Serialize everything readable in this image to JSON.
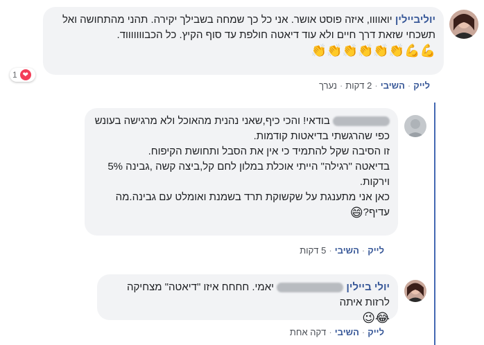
{
  "comment1": {
    "author": "יוליביילין",
    "text": "יואוווו, איזה פוסט אושר. אני כל כך שמחה בשבילך יקירה. תהני מהתחושה ואל תשכחי שזאת דרך חיים ולא עוד דיאטה חולפת עד סוף הקיץ. כל הכבוווווווד.",
    "emojis": "💪💪👏👏👏👏👏👏",
    "reaction_count": "1",
    "actions": {
      "like": "לייק",
      "reply": "השיבי",
      "time": "2 דקות",
      "edited": "נערך"
    }
  },
  "reply1": {
    "text_line1": "בודאי! והכי כיף,שאני נהנית מהאוכל ולא מרגישה בעונש",
    "text_line2": "כפי שהרגשתי בדיאטות קודמות.",
    "text_line3": "זו הסיבה שקל להתמיד כי אין את הסבל ותחושת הקיפוח.",
    "text_line4": "בדיאטה \"רגילה\" הייתי אוכלת במלון לחם קל,ביצה קשה ,גבינה 5%",
    "text_line5": "וירקות.",
    "text_line6": "כאן אני מתענגת על שקשוקת תרד בשמנת ואומלט עם גבינה.מה",
    "text_line7": "עדיף?",
    "emoji": "😄",
    "actions": {
      "like": "לייק",
      "reply": "השיבי",
      "time": "5 דקות"
    }
  },
  "reply2": {
    "author": "יולי ביילין",
    "text": "יאמי. חחחח איזו \"דיאטה\" מצחיקה לרזות איתה",
    "emojis": "😂😉",
    "actions": {
      "like": "לייק",
      "reply": "השיבי",
      "time": "דקה אחת"
    }
  },
  "colors": {
    "link": "#385898",
    "bubble": "#f2f3f5",
    "thread": "#4267b2",
    "heart": "#f33e58"
  }
}
